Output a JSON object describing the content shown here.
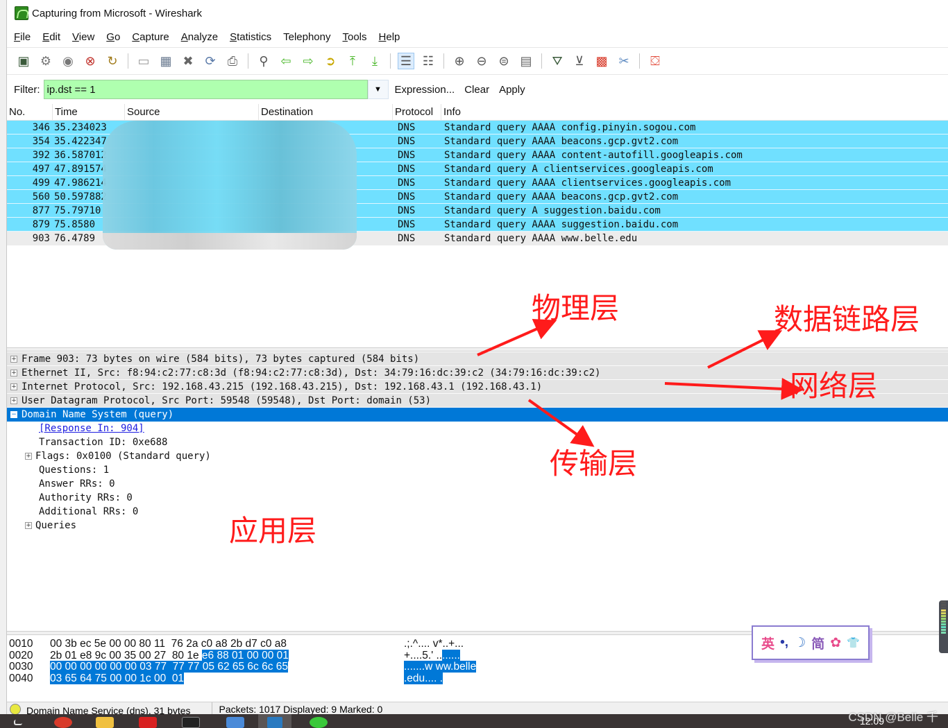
{
  "window": {
    "title": "Capturing from Microsoft - Wireshark"
  },
  "menu": [
    {
      "label": "File",
      "u": "F",
      "rest": "ile"
    },
    {
      "label": "Edit",
      "u": "E",
      "rest": "dit"
    },
    {
      "label": "View",
      "u": "V",
      "rest": "iew"
    },
    {
      "label": "Go",
      "u": "G",
      "rest": "o"
    },
    {
      "label": "Capture",
      "u": "C",
      "rest": "apture"
    },
    {
      "label": "Analyze",
      "u": "A",
      "rest": "nalyze"
    },
    {
      "label": "Statistics",
      "u": "S",
      "rest": "tatistics"
    },
    {
      "label": "Telephony",
      "u": "",
      "rest": "Telephony"
    },
    {
      "label": "Tools",
      "u": "T",
      "rest": "ools"
    },
    {
      "label": "Help",
      "u": "H",
      "rest": "elp"
    }
  ],
  "toolbar": {
    "icons": [
      {
        "name": "interfaces-icon",
        "glyph": "▣",
        "color": "#3a5a3a"
      },
      {
        "name": "capture-options-icon",
        "glyph": "⚙",
        "color": "#777"
      },
      {
        "name": "start-capture-icon",
        "glyph": "◉",
        "color": "#777"
      },
      {
        "name": "stop-capture-icon",
        "glyph": "⊗",
        "color": "#c0302a"
      },
      {
        "name": "restart-capture-icon",
        "glyph": "↻",
        "color": "#a07a1a"
      },
      {
        "sep": true
      },
      {
        "name": "open-file-icon",
        "glyph": "▭",
        "color": "#999"
      },
      {
        "name": "save-file-icon",
        "glyph": "▦",
        "color": "#6a7a90"
      },
      {
        "name": "close-file-icon",
        "glyph": "✖",
        "color": "#666"
      },
      {
        "name": "reload-icon",
        "glyph": "⟳",
        "color": "#5a7aa8"
      },
      {
        "name": "print-icon",
        "glyph": "⎙",
        "color": "#666"
      },
      {
        "sep": true
      },
      {
        "name": "find-packet-icon",
        "glyph": "⚲",
        "color": "#555"
      },
      {
        "name": "go-back-icon",
        "glyph": "⇦",
        "color": "#4cb82c"
      },
      {
        "name": "go-forward-icon",
        "glyph": "⇨",
        "color": "#4cb82c"
      },
      {
        "name": "go-to-packet-icon",
        "glyph": "➲",
        "color": "#c8a800"
      },
      {
        "name": "go-first-icon",
        "glyph": "⤒",
        "color": "#4cb82c"
      },
      {
        "name": "go-last-icon",
        "glyph": "⤓",
        "color": "#4cb82c"
      },
      {
        "sep": true
      },
      {
        "name": "colorize-icon",
        "glyph": "☰",
        "color": "#555",
        "active": true
      },
      {
        "name": "auto-scroll-icon",
        "glyph": "☷",
        "color": "#555"
      },
      {
        "sep": true
      },
      {
        "name": "zoom-in-icon",
        "glyph": "⊕",
        "color": "#555"
      },
      {
        "name": "zoom-out-icon",
        "glyph": "⊖",
        "color": "#555"
      },
      {
        "name": "zoom-normal-icon",
        "glyph": "⊜",
        "color": "#555"
      },
      {
        "name": "resize-columns-icon",
        "glyph": "▤",
        "color": "#666"
      },
      {
        "sep": true
      },
      {
        "name": "capture-filters-icon",
        "glyph": "⛛",
        "color": "#3a5a3a"
      },
      {
        "name": "display-filters-icon",
        "glyph": "⊻",
        "color": "#555"
      },
      {
        "name": "coloring-rules-icon",
        "glyph": "▩",
        "color": "#d83a2a"
      },
      {
        "name": "preferences-icon",
        "glyph": "✂",
        "color": "#5a88c0"
      },
      {
        "sep": true
      },
      {
        "name": "help-icon",
        "glyph": "⛋",
        "color": "#e24a3a"
      }
    ]
  },
  "filter": {
    "label": "Filter:",
    "value": "ip.dst == 1",
    "expression_label": "Expression...",
    "clear_label": "Clear",
    "apply_label": "Apply"
  },
  "packet_list": {
    "columns": [
      "No.",
      "Time",
      "Source",
      "Destination",
      "Protocol",
      "Info"
    ],
    "rows": [
      {
        "no": "346",
        "time": "35.234023",
        "protocol": "DNS",
        "info": "Standard query AAAA config.pinyin.sogou.com",
        "style": "dns"
      },
      {
        "no": "354",
        "time": "35.422347",
        "protocol": "DNS",
        "info": "Standard query AAAA beacons.gcp.gvt2.com",
        "style": "dns"
      },
      {
        "no": "392",
        "time": "36.587012",
        "protocol": "DNS",
        "info": "Standard query AAAA content-autofill.googleapis.com",
        "style": "dns"
      },
      {
        "no": "497",
        "time": "47.891574",
        "protocol": "DNS",
        "info": "Standard query A clientservices.googleapis.com",
        "style": "dns"
      },
      {
        "no": "499",
        "time": "47.986214",
        "protocol": "DNS",
        "info": "Standard query AAAA clientservices.googleapis.com",
        "style": "dns"
      },
      {
        "no": "560",
        "time": "50.597882",
        "protocol": "DNS",
        "info": "Standard query AAAA beacons.gcp.gvt2.com",
        "style": "dns"
      },
      {
        "no": "877",
        "time": "75.79710",
        "protocol": "DNS",
        "info": "Standard query A suggestion.baidu.com",
        "style": "dns"
      },
      {
        "no": "879",
        "time": "75.8580",
        "protocol": "DNS",
        "info": "Standard query AAAA suggestion.baidu.com",
        "style": "dns"
      },
      {
        "no": "903",
        "time": "76.4789",
        "protocol": "DNS",
        "info": "Standard query AAAA www.belle.edu",
        "style": "plain"
      }
    ]
  },
  "details": {
    "top": [
      "Frame 903: 73 bytes on wire (584 bits), 73 bytes captured (584 bits)",
      "Ethernet II, Src: f8:94:c2:77:c8:3d (f8:94:c2:77:c8:3d), Dst: 34:79:16:dc:39:c2 (34:79:16:dc:39:c2)",
      "Internet Protocol, Src: 192.168.43.215 (192.168.43.215), Dst: 192.168.43.1 (192.168.43.1)",
      "User Datagram Protocol, Src Port: 59548 (59548), Dst Port: domain (53)"
    ],
    "selected": "Domain Name System (query)",
    "response_link": "[Response In: 904]",
    "transaction_id": "Transaction ID: 0xe688",
    "flags": "Flags: 0x0100 (Standard query)",
    "questions": "Questions: 1",
    "answer_rrs": "Answer RRs: 0",
    "authority_rrs": "Authority RRs: 0",
    "additional_rrs": "Additional RRs: 0",
    "queries": "Queries"
  },
  "hex": {
    "rows": [
      {
        "offset": "0010",
        "plain": "00 3b ec 5e 00 00 80 11  76 2a c0 a8 2b d7 c0 a8",
        "hl": "",
        "ascii_plain": ".;.^.... v*..+...",
        "ascii_hl": ""
      },
      {
        "offset": "0020",
        "plain": "2b 01 e8 9c 00 35 00 27  80 1e ",
        "hl": "e6 88 01 00 00 01",
        "ascii_plain": "+....5.' ..",
        "ascii_hl": "......"
      },
      {
        "offset": "0030",
        "plain": "",
        "hl": "00 00 00 00 00 00 03 77  77 77 05 62 65 6c 6c 65",
        "ascii_plain": "",
        "ascii_hl": ".......w ww.belle"
      },
      {
        "offset": "0040",
        "plain": "",
        "hl": "03 65 64 75 00 00 1c 00  01",
        "ascii_plain": "",
        "ascii_hl": ".edu.... ."
      }
    ]
  },
  "status": {
    "left": "Domain Name Service (dns), 31 bytes",
    "right": "Packets: 1017 Displayed: 9 Marked: 0"
  },
  "annotations": {
    "physical": "物理层",
    "datalink": "数据链路层",
    "network": "网络层",
    "transport": "传输层",
    "application": "应用层"
  },
  "ime": {
    "lang": "英",
    "punct": "•,",
    "moon": "☽",
    "mode": "简",
    "gear": "✿",
    "skin": "👕"
  },
  "taskbar": {
    "clock": "12:09"
  },
  "watermark": "CSDN @Belle 千"
}
